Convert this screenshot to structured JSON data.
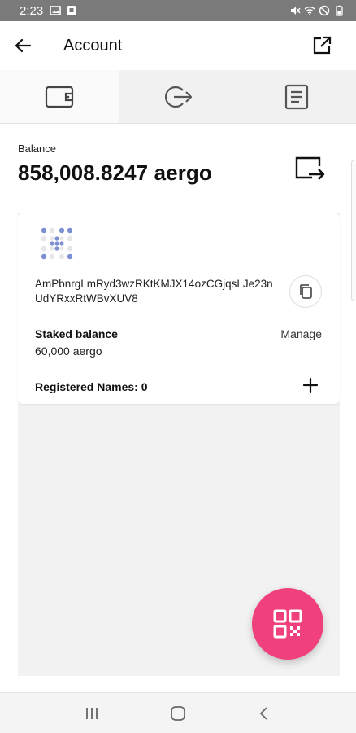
{
  "status_bar": {
    "time": "2:23"
  },
  "header": {
    "title": "Account"
  },
  "tabs": [
    {
      "name": "wallet",
      "icon": "wallet-icon",
      "active": true
    },
    {
      "name": "send",
      "icon": "logout-arrow-icon",
      "active": false
    },
    {
      "name": "history",
      "icon": "document-icon",
      "active": false
    }
  ],
  "balance": {
    "label": "Balance",
    "value": "858,008.8247 aergo"
  },
  "account_card": {
    "address": "AmPbnrgLmRyd3wzRKtKMJX14ozCGjqsLJe23nUdYRxxRtWBvXUV8",
    "staked_label": "Staked balance",
    "staked_value": "60,000 aergo",
    "manage_label": "Manage",
    "registered_names_label": "Registered Names: 0"
  },
  "colors": {
    "fab": "#f0407e",
    "identicon": "#7b8fd1",
    "status_bar": "#7a7a7a"
  }
}
